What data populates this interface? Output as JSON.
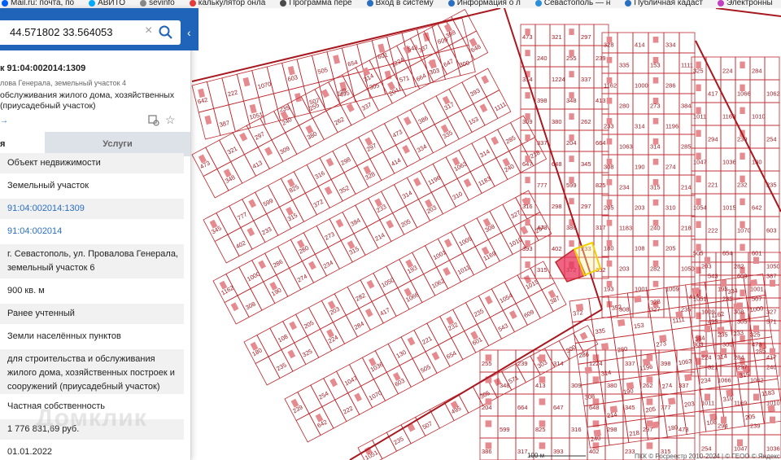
{
  "bookmarks": [
    {
      "label": "Mail.ru: почта, по",
      "color": "#005ff9"
    },
    {
      "label": "АВИТО",
      "color": "#00aaff"
    },
    {
      "label": "sevinfo",
      "color": "#888888"
    },
    {
      "label": "калькулятор онла",
      "color": "#e83a3a"
    },
    {
      "label": "Программа пере",
      "color": "#4a4a4a"
    },
    {
      "label": "Вход в систему",
      "color": "#2a6fc0"
    },
    {
      "label": "Информация о л",
      "color": "#2a6fc0"
    },
    {
      "label": "Севастополь — н",
      "color": "#2a8fd8"
    },
    {
      "label": "Публичная кадаст",
      "color": "#2a6fc0"
    },
    {
      "label": "Электронны",
      "color": "#c040c0"
    }
  ],
  "search": {
    "value": "44.571802 33.564053"
  },
  "object": {
    "title": "к 91:04:002014:1309",
    "address": "лова Генерала, земельный участок 4",
    "purpose": "обслуживания жилого дома, хозяйственных (приусадебный участок)",
    "link_arrow": "→"
  },
  "tabs": {
    "info": "я",
    "services": "Услуги"
  },
  "details": [
    "Объект недвижимости",
    "Земельный участок",
    "91:04:002014:1309",
    "91:04:002014",
    "г. Севастополь, ул. Провалова Генерала, земельный участок 6",
    "900 кв. м",
    "Ранее учтенный",
    "Земли населённых пунктов",
    "для строительства и обслуживания жилого дома, хозяйственных построек и сооружений (приусадебный участок)",
    "Частная собственность",
    "1 776 831,69 руб.",
    "01.01.2022"
  ],
  "watermark": "Домклик",
  "map": {
    "scale_label": "100 м",
    "copyright": "ПКК © Росреестр 2010-2024 | © ГЕОО © Яндекс",
    "parcel_color": "#c0282e",
    "highlight_fill": "#e8325a",
    "selected_outline": "#f0d000",
    "parcel_numbers": [
      "642",
      "222",
      "1070",
      "603",
      "505",
      "654",
      "601",
      "543",
      "609",
      "387",
      "1051",
      "235",
      "507",
      "495",
      "305",
      "571",
      "303",
      "300",
      "473",
      "321",
      "297",
      "240",
      "255",
      "239",
      "314",
      "1224",
      "337",
      "398",
      "348",
      "413",
      "309",
      "380",
      "262",
      "337",
      "204",
      "664",
      "647",
      "648",
      "345",
      "777",
      "599",
      "825",
      "316",
      "298",
      "297",
      "473",
      "386",
      "317",
      "393",
      "402",
      "233",
      "315",
      "372",
      "352",
      "328",
      "414",
      "334",
      "335",
      "153",
      "1111",
      "1162",
      "1000",
      "286",
      "280",
      "273",
      "384",
      "233",
      "314",
      "1196",
      "1063",
      "314",
      "285",
      "308",
      "190",
      "274",
      "234",
      "315",
      "214",
      "205",
      "203",
      "310",
      "1183",
      "240",
      "218",
      "180",
      "108",
      "205",
      "203",
      "282",
      "1050",
      "193",
      "1001",
      "1009",
      "308",
      "327",
      "235",
      "325",
      "224",
      "284",
      "417",
      "1066",
      "1062",
      "1011",
      "1169",
      "1010",
      "294",
      "239",
      "254",
      "1047",
      "1036",
      "130",
      "221",
      "232",
      "235",
      "1054",
      "1015"
    ]
  }
}
